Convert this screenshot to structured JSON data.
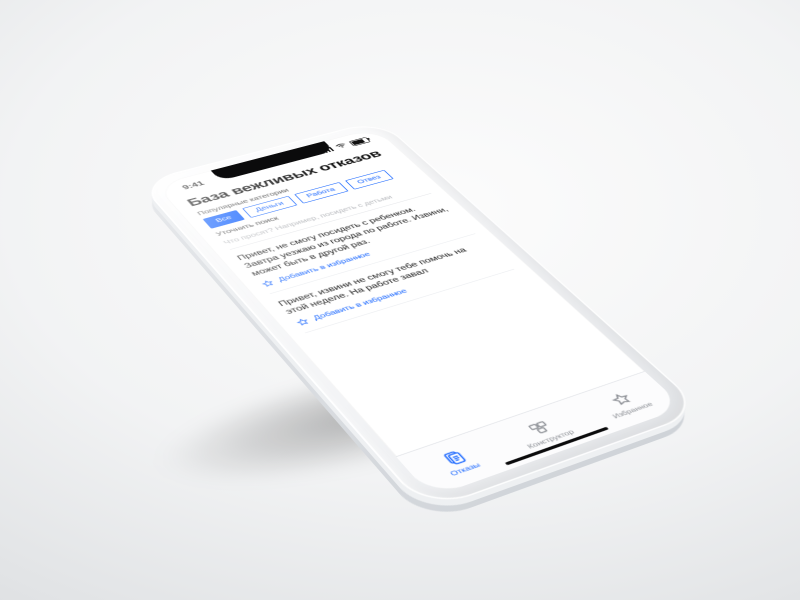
{
  "status": {
    "time": "9:41"
  },
  "header": {
    "title": "База вежливых отказов",
    "categories_label": "Популярные категории",
    "chips": [
      "Все",
      "Деньги",
      "Работа",
      "Отвез"
    ],
    "refine_label": "Уточнить поиск",
    "search_placeholder": "Что просят? Например, посидеть с детьми"
  },
  "fav_label": "Добавить в избранное",
  "cards": [
    {
      "text": "Привет, не смогу посидеть с ребенком. Завтра уезжаю из города по работе. Извини, может быть в другой раз."
    },
    {
      "text": "Привет, извини не смогу тебе помочь на этой неделе. На работе завал"
    }
  ],
  "tabs": [
    {
      "label": "Отказы"
    },
    {
      "label": "Конструктор"
    },
    {
      "label": "Избранное"
    }
  ]
}
